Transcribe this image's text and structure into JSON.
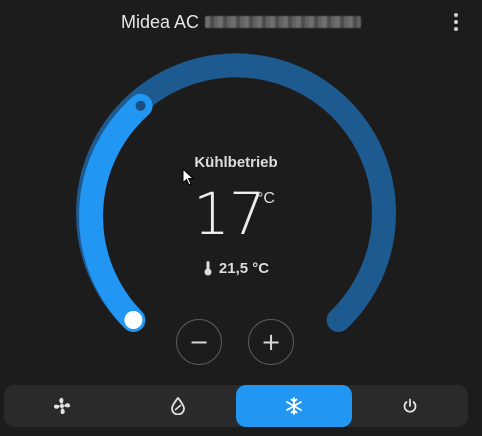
{
  "header": {
    "title": "Midea AC",
    "menu_icon": "more-vertical-icon"
  },
  "thermostat": {
    "mode_label": "Kühlbetrieb",
    "target_temperature": "17",
    "unit": "°C",
    "current_temperature": "21,5 °C",
    "current_icon": "thermometer-icon",
    "target_fraction": 0.0
  },
  "controls": {
    "decrease_label": "−",
    "increase_label": "+"
  },
  "modes": [
    {
      "icon": "fan-icon",
      "active": false
    },
    {
      "icon": "dry-icon",
      "active": false
    },
    {
      "icon": "snowflake-icon",
      "active": true
    },
    {
      "icon": "power-icon",
      "active": false
    }
  ],
  "colors": {
    "accent": "#2196f3",
    "track": "#1d5a90",
    "background": "#1c1c1c",
    "mode_bar": "#2a2a2a"
  }
}
